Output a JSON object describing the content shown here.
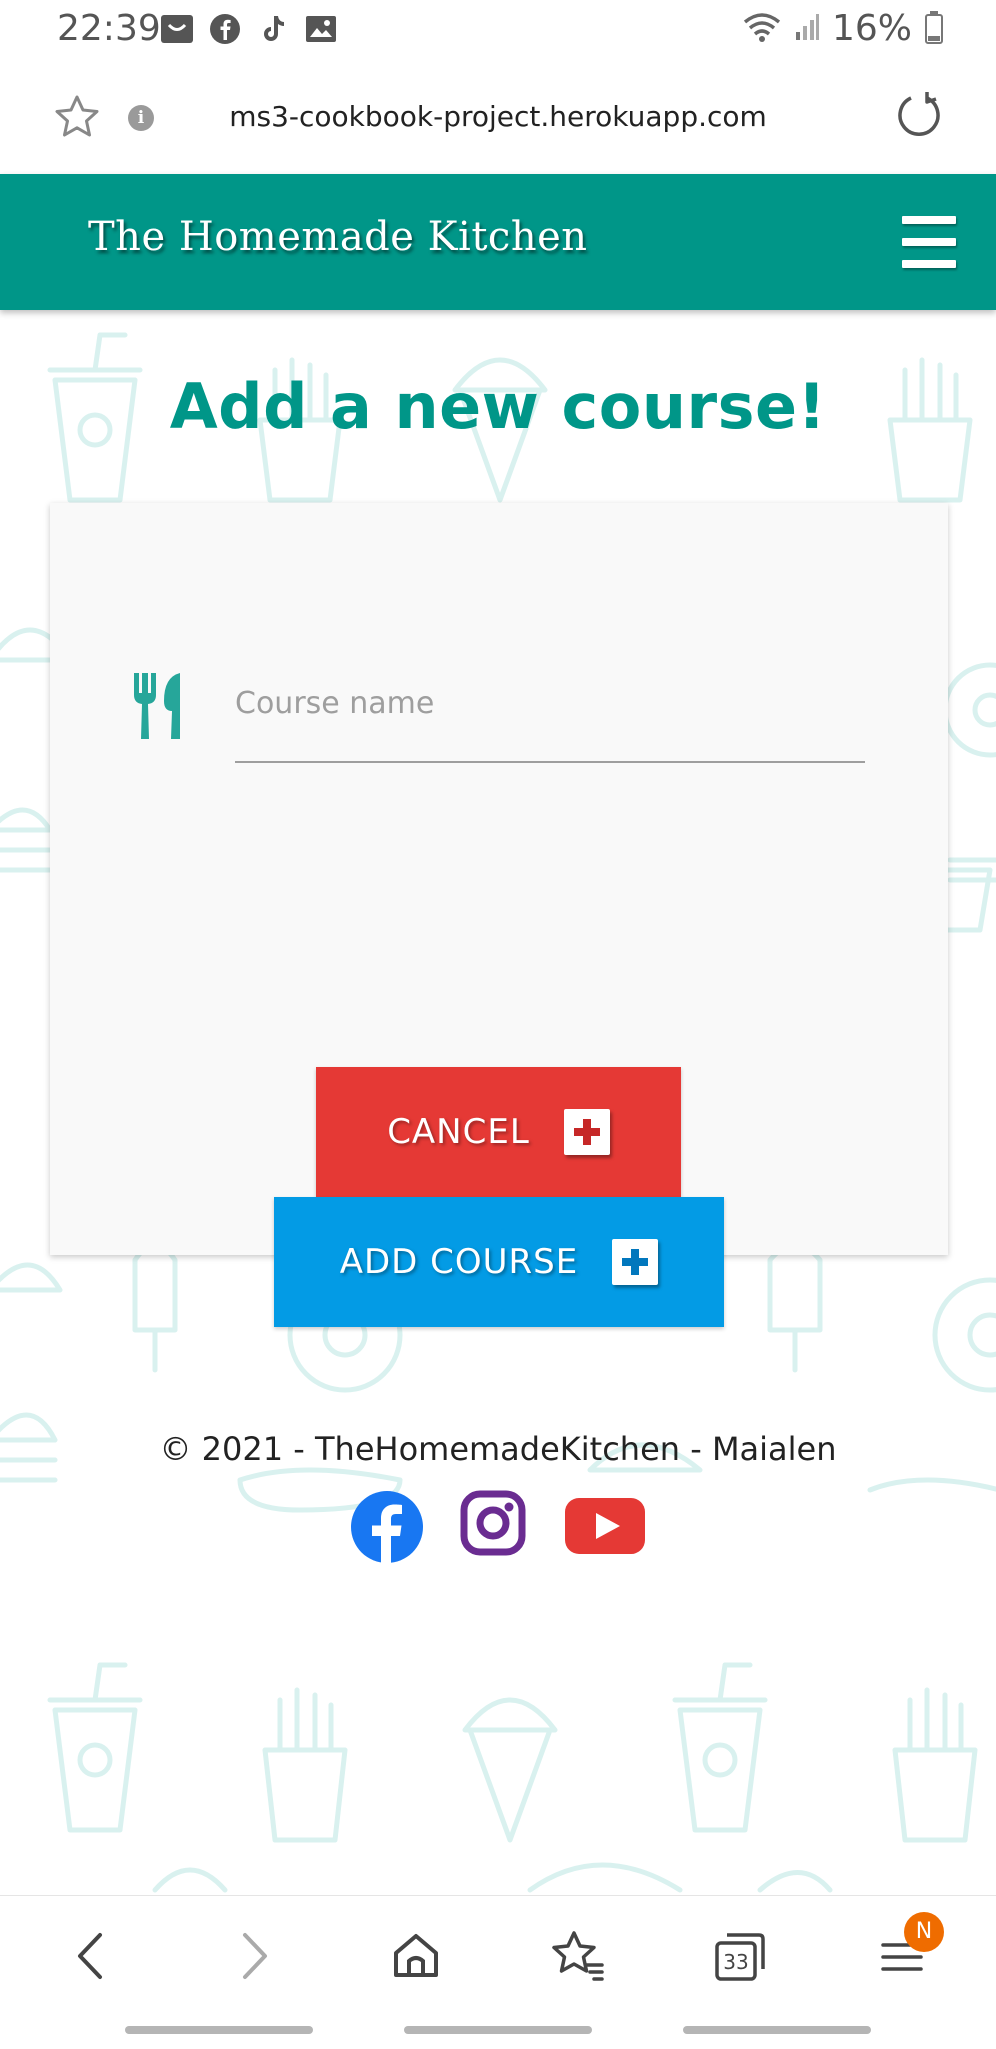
{
  "status_bar": {
    "time": "22:39",
    "battery": "16%",
    "left_icons": [
      "shop-icon",
      "facebook-icon",
      "tiktok-icon",
      "gallery-icon"
    ],
    "right_icons": [
      "wifi-icon",
      "signal-icon",
      "battery-icon"
    ]
  },
  "browser": {
    "url": "ms3-cookbook-project.herokuapp.com",
    "tab_count": "33",
    "menu_badge": "N"
  },
  "header": {
    "brand": "The Homemade Kitchen"
  },
  "page": {
    "title": "Add a new course!"
  },
  "form": {
    "course_placeholder": "Course name",
    "course_value": "",
    "cancel_label": "CANCEL",
    "add_label": "ADD COURSE"
  },
  "footer": {
    "copyright": "© 2021 - TheHomemadeKitchen - Maialen"
  },
  "colors": {
    "primary": "#009688",
    "cancel": "#e53935",
    "add": "#039be5",
    "facebook": "#1877f2",
    "instagram": "#6a2c91",
    "youtube": "#e53935"
  }
}
